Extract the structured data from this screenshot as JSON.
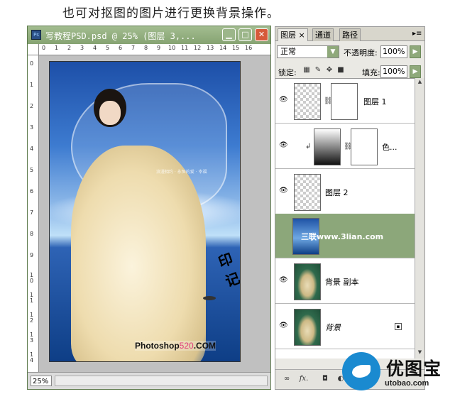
{
  "caption": "也可对抠图的图片进行更换背景操作。",
  "document": {
    "title": "写教程PSD.psd @ 25% (图层 3,...",
    "ruler_top": [
      "0",
      "1",
      "2",
      "3",
      "4",
      "5",
      "6",
      "7",
      "8",
      "9",
      "10",
      "11",
      "12",
      "13",
      "14",
      "15",
      "16"
    ],
    "ruler_left": [
      "0",
      "1",
      "2",
      "3",
      "4",
      "5",
      "6",
      "7",
      "8",
      "9",
      "10",
      "11",
      "12",
      "13",
      "14"
    ],
    "zoom": "25%",
    "watermark_prefix": "Photoshop",
    "watermark_number": "520",
    "watermark_suffix": ".COM"
  },
  "panel": {
    "tabs": [
      "图层",
      "通道",
      "路径"
    ],
    "blend_mode": "正常",
    "opacity_label": "不透明度:",
    "opacity_value": "100%",
    "lock_label": "锁定:",
    "fill_label": "填充:",
    "fill_value": "100%",
    "layers": [
      {
        "name": "图层 1",
        "selected": false
      },
      {
        "name": "色...",
        "selected": false
      },
      {
        "name": "图层 2",
        "selected": false
      },
      {
        "name": "",
        "selected": true
      },
      {
        "name": "背景 副本",
        "selected": false
      },
      {
        "name": "背景",
        "selected": false
      }
    ],
    "selected_layer_thumb_text": "三联www.3lian.com",
    "bottom_icons": [
      "link-icon",
      "fx-icon",
      "mask-icon",
      "adjustment-icon",
      "group-icon",
      "new-layer-icon",
      "trash-icon"
    ]
  },
  "photo": {
    "signature": "印记",
    "tagline": "浪漫相约 · 永恒的爱 · 幸福"
  },
  "brand": {
    "name": "优图宝",
    "url": "utobao.com",
    "accent": "#1a8ad0"
  },
  "colors": {
    "window_green": "#8ca77a",
    "selected_row": "#8ca77a"
  }
}
